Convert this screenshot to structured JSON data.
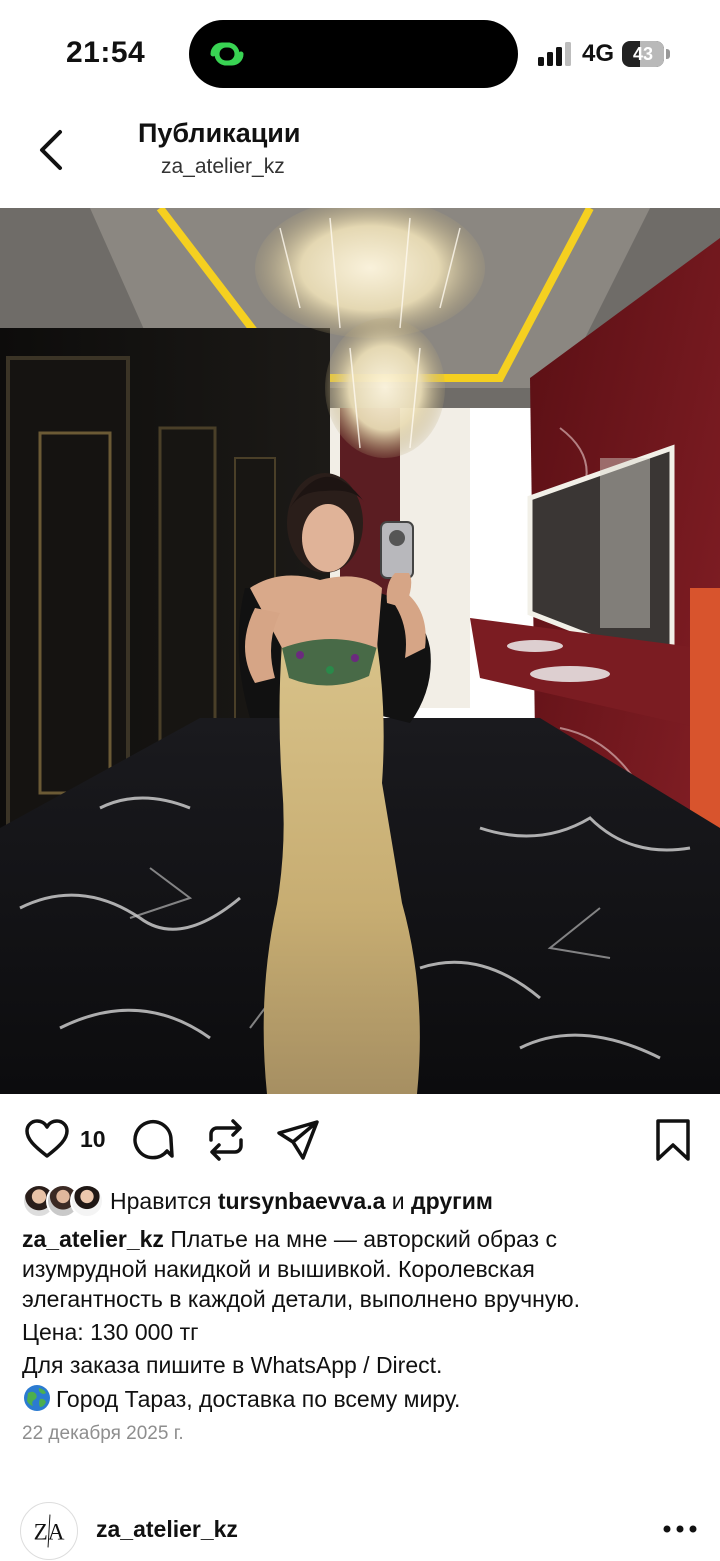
{
  "status_bar": {
    "time": "21:54",
    "network": "4G",
    "battery_percent": "43",
    "battery_level": 0.43,
    "icons": [
      "app-activity-icon",
      "signal-icon",
      "battery-icon"
    ]
  },
  "header": {
    "title": "Публикации",
    "subtitle": "za_atelier_kz",
    "back_icon": "chevron-left-icon"
  },
  "post": {
    "image_description_icon": "photo",
    "actions": {
      "like_count": "10",
      "icons": [
        "heart-icon",
        "comment-icon",
        "repost-icon",
        "send-icon",
        "bookmark-icon"
      ]
    },
    "likes": {
      "prefix": "Нравится ",
      "user": "tursynbaevva.a",
      "middle": " и ",
      "others": "другим"
    },
    "caption": {
      "username": "za_atelier_kz",
      "line1": " Платье на мне — авторский образ с",
      "line2": "изумрудной накидкой и вышивкой. Королевская",
      "line3": "элегантность в каждой детали, выполнено вручную.",
      "line4": "Цена: 130 000 тг",
      "line5": "Для заказа пишите в WhatsApp / Direct.",
      "line6": "Город Тараз, доставка по всему миру."
    },
    "date": "22 декабря 2025 г."
  },
  "next_post": {
    "avatar_logo": "ZA",
    "username": "za_atelier_kz",
    "more_icon": "more-horizontal-icon"
  },
  "colors": {
    "accent_green": "#39d353",
    "ceiling_light": "#f5d020",
    "marble_red": "#7a1a1f"
  }
}
